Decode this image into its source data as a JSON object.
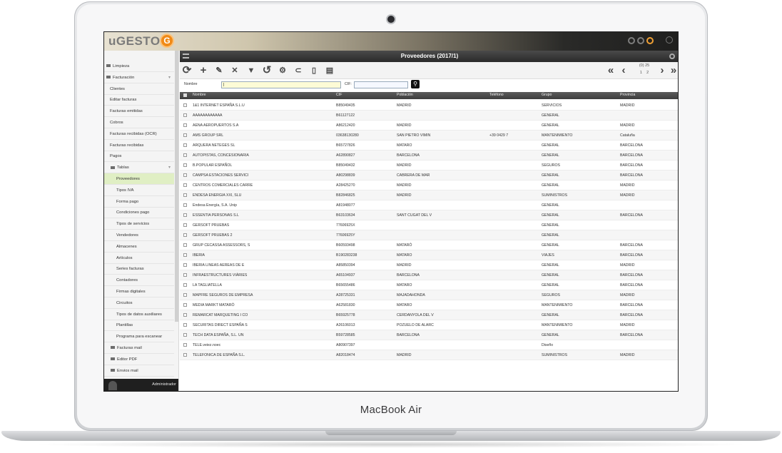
{
  "device": {
    "brand": "MacBook Air"
  },
  "app": {
    "logo_text": "uGESTOR",
    "logo_mark": "G",
    "window_title": "Proveedores (2017/1)",
    "user": "Administrador"
  },
  "sidebar": {
    "items": [
      {
        "label": "Limpieza",
        "type": "folder"
      },
      {
        "label": "Facturación",
        "type": "folder",
        "arrow": "▾"
      },
      {
        "label": "Clientes",
        "type": "link"
      },
      {
        "label": "Editar facturas",
        "type": "link"
      },
      {
        "label": "Facturas emitidas",
        "type": "link"
      },
      {
        "label": "Cobros",
        "type": "link"
      },
      {
        "label": "Facturas recibidas (OCR)",
        "type": "link"
      },
      {
        "label": "Facturas recibidas",
        "type": "link"
      },
      {
        "label": "Pagos",
        "type": "link"
      },
      {
        "label": "Tablas",
        "type": "subfolder",
        "arrow": "▾"
      },
      {
        "label": "Proveedores",
        "type": "sublink",
        "active": true
      },
      {
        "label": "Tipos IVA",
        "type": "sublink"
      },
      {
        "label": "Forma pago",
        "type": "sublink"
      },
      {
        "label": "Condiciones pago",
        "type": "sublink"
      },
      {
        "label": "Tipos de servicios",
        "type": "sublink"
      },
      {
        "label": "Vendedores",
        "type": "sublink"
      },
      {
        "label": "Almacenes",
        "type": "sublink"
      },
      {
        "label": "Artículos",
        "type": "sublink"
      },
      {
        "label": "Series facturas",
        "type": "sublink"
      },
      {
        "label": "Contadores",
        "type": "sublink"
      },
      {
        "label": "Firmas digitales",
        "type": "sublink"
      },
      {
        "label": "Circuitos",
        "type": "sublink"
      },
      {
        "label": "Tipos de datos auxiliares",
        "type": "sublink"
      },
      {
        "label": "Plantillas",
        "type": "sublink"
      },
      {
        "label": "Programa para escanear",
        "type": "sublink"
      },
      {
        "label": "Facturas mail",
        "type": "subfolder"
      },
      {
        "label": "Editor PDF",
        "type": "subfolder"
      },
      {
        "label": "Envios mail",
        "type": "subfolder"
      }
    ]
  },
  "toolbar": {
    "tools": [
      "refresh-icon",
      "add-icon",
      "edit-icon",
      "delete-icon",
      "filter-icon",
      "undo-icon",
      "settings-icon",
      "attach-icon",
      "document-icon",
      "report-icon"
    ],
    "pager_top": "(0) 25",
    "pages": [
      "1",
      "2"
    ]
  },
  "filters": {
    "nombre_label": "Nombre",
    "nombre_value": "|",
    "cif_label": "CIF:",
    "cif_value": ""
  },
  "grid": {
    "columns": [
      "Nombre",
      "CIF",
      "Población",
      "Teléfono",
      "Grupo",
      "Provincia"
    ],
    "rows": [
      [
        "1&1 INTERNET ESPAÑA S.L.U",
        "B85049435",
        "MADRID",
        "",
        "SERVICIOS",
        "MADRID"
      ],
      [
        "AAAAAAAAAAAA",
        "B61127122",
        "",
        "",
        "GENERAL",
        ""
      ],
      [
        "AENA AEROPUERTOS S.A",
        "A86212420",
        "MADRID",
        "",
        "GENERAL",
        "MADRID"
      ],
      [
        "AMS GROUP SRL",
        "03638130280",
        "SAN PIETRO VIMIN",
        "+39 0429 7",
        "MANTENIMIENTO",
        "Cataluña"
      ],
      [
        "ARQUERA NETEGES SL",
        "B65727826",
        "MATARO",
        "",
        "GENERAL",
        "BARCELONA"
      ],
      [
        "AUTOPISTAS, CONCESIONARIA",
        "A62890827",
        "BARCELONA",
        "",
        "GENERAL",
        "BARCELONA"
      ],
      [
        "B.POPULAR ESPAÑOL",
        "B85049432",
        "MADRID",
        "",
        "SEGUROS",
        "BARCELONA"
      ],
      [
        "CAMPSA ESTACIONES SERVICI",
        "A80298839",
        "CABRERA DE MAR",
        "",
        "GENERAL",
        "BARCELONA"
      ],
      [
        "CENTROS COMERCIALES CARRE",
        "A28425270",
        "MADRID",
        "",
        "GENERAL",
        "MADRID"
      ],
      [
        "ENDESA ENERGIA XXI, SLU",
        "B82846825",
        "MADRID",
        "",
        "SUMINISTROS",
        "MADRID"
      ],
      [
        "Endesa Energía, S.A. Unip",
        "A81948077",
        "",
        "",
        "GENERAL",
        ""
      ],
      [
        "ESSENTIA PERSONAS S.L",
        "B63103634",
        "SANT CUGAT DEL V",
        "",
        "GENERAL",
        "BARCELONA"
      ],
      [
        "GERSOFT PRUEBAS",
        "77606925X",
        "",
        "",
        "GENERAL",
        ""
      ],
      [
        "GERSOFT PRUEBAS 2",
        "77606925Y",
        "",
        "",
        "GENERAL",
        ""
      ],
      [
        "GRUP CECASSA ASSESSORS, S",
        "B60593498",
        "MATARÓ",
        "",
        "GENERAL",
        "BARCELONA"
      ],
      [
        "IBERIA",
        "B190283238",
        "MATARO",
        "",
        "VIAJES",
        "BARCELONA"
      ],
      [
        "IBERIA LINEAS AEREAS DE E",
        "A85850394",
        "MADRID",
        "",
        "GENERAL",
        "MADRID"
      ],
      [
        "INFRAESTRUCTURES VIÀRIES",
        "A65104937",
        "BARCELONA",
        "",
        "GENERAL",
        "BARCELONA"
      ],
      [
        "LA TAGLIATELLA",
        "B65655486",
        "MATARO",
        "",
        "GENERAL",
        "BARCELONA"
      ],
      [
        "MAPFRE SEGUROS DE EMPRESA",
        "A28725331",
        "MAJADAHONDA",
        "",
        "SEGUROS",
        "MADRID"
      ],
      [
        "MEDIA MARKT MATARÓ",
        "A62581830",
        "MATARO",
        "",
        "MANTENIMIENTO",
        "BARCELONA"
      ],
      [
        "REMARCAT MARQUETING I CO",
        "B65925778",
        "CERDANYOLA DEL V",
        "",
        "GENERAL",
        "BARCELONA"
      ],
      [
        "SECURITAS DIRECT ESPAÑA S",
        "A26106013",
        "POZUELO DE ALARC",
        "",
        "MANTENIMIENTO",
        "MADRID"
      ],
      [
        "TECH DATA ESPAÑA, S.L. UN",
        "B59728585",
        "BARCELONA",
        "",
        "GENERAL",
        "BARCELONA"
      ],
      [
        "TELE.veiez.noec",
        "A80907397",
        "",
        "",
        "Diseño",
        ""
      ],
      [
        "TELEFONICA DE ESPAÑA S.L.",
        "A82018474",
        "MADRID",
        "",
        "SUMINISTROS",
        "MADRID"
      ]
    ]
  }
}
